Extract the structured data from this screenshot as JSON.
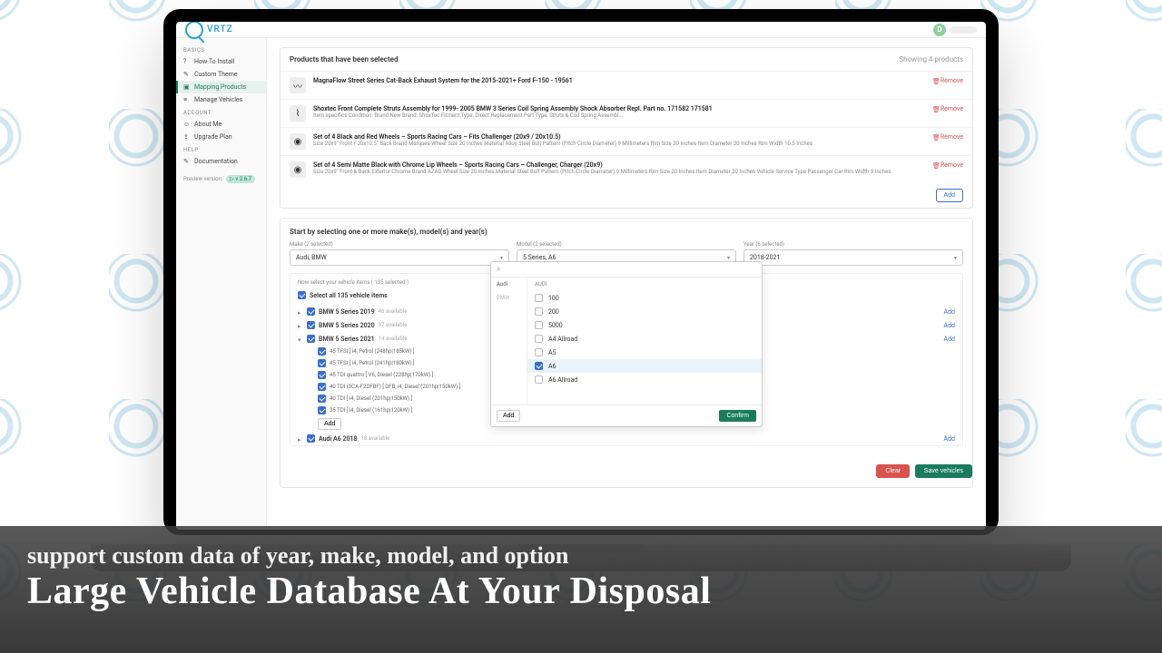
{
  "brand": "VRTZ",
  "avatar_letter": "D",
  "sidebar": {
    "groups": [
      {
        "label": "BASICS",
        "items": [
          {
            "label": "How To Install",
            "icon": "?",
            "active": false
          },
          {
            "label": "Custom Theme",
            "icon": "✎",
            "active": false
          },
          {
            "label": "Mapping Products",
            "icon": "▣",
            "active": true
          },
          {
            "label": "Manage Vehicles",
            "icon": "≡",
            "active": false
          }
        ]
      },
      {
        "label": "ACCOUNT",
        "items": [
          {
            "label": "About Me",
            "icon": "☺",
            "active": false
          },
          {
            "label": "Upgrade Plan",
            "icon": "⇪",
            "active": false
          }
        ]
      },
      {
        "label": "HELP",
        "items": [
          {
            "label": "Documentation",
            "icon": "✎",
            "active": false
          }
        ]
      }
    ],
    "preview_label": "Preview version:",
    "version": "▷ v 2.6.7"
  },
  "products_panel": {
    "title": "Products that have been selected",
    "count_label": "Showing 4 products",
    "remove_label": "Remove",
    "add_label": "Add",
    "items": [
      {
        "title": "MagnaFlow Street Series Cat-Back Exhaust System for the 2015-2021+ Ford F-150 - 19561",
        "sub": ""
      },
      {
        "title": "Shoxtec Front Complete Struts Assembly for 1999- 2005 BMW 3 Series Coil Spring Assembly Shock Absorber Repl. Part no. 171582 171581",
        "sub": "Item specifics Condition: Brand New Brand: ShoxTec Fitment Type: Direct Replacement Part Type: Struts & Coil Spring Assembl..."
      },
      {
        "title": "Set of 4 Black and Red Wheels – Sports Racing Cars – Fits Challenger (20x9 / 20x10.5)",
        "sub": "Size 20x9\" Front / 20x10.5\" Back Brand Marquee Wheel Size 20 Inches Material Alloy Steel Bolt Pattern (Pitch Circle Diameter) 9 Millimeters Rim Size 20 Inches Item Diameter 20 Inches Rim Width 10.5 Inches"
      },
      {
        "title": "Set of 4 Semi Matte Black with Chrome Lip Wheels – Sports Racing Cars – Challenger, Charger (20x9)",
        "sub": "Size 20x9\" Front & Back Exterior Chrome Brand AZAD Wheel Size 20 Inches Material Steel Bolt Pattern (Pitch Circle Diameter) 9 Millimeters Rim Size 20 Inches Item Diameter 20 Inches Vehicle Service Type Passenger Car Rim Width 9 Inches"
      }
    ]
  },
  "step": {
    "title": "Start by selecting one or more make(s), model(s) and year(s)",
    "make": {
      "label": "Make (2 selected)",
      "value": "Audi, BMW"
    },
    "model": {
      "label": "Model (2 selected)",
      "value": "5 Series, A6"
    },
    "year": {
      "label": "Year (6 selected)",
      "value": "2018-2021"
    }
  },
  "tree": {
    "head": "Now select your vehicle items ( 135 selected )",
    "select_all": "Select all 135 vehicle items",
    "add_label": "Add",
    "groups": [
      {
        "label": "BMW 5 Series 2019",
        "avail": "46 available",
        "expanded": false
      },
      {
        "label": "BMW 5 Series 2020",
        "avail": "37 available",
        "expanded": false
      },
      {
        "label": "BMW 5 Series 2021",
        "avail": "14 available",
        "expanded": true,
        "children": [
          "45 TFSI [ i4, Petrol (248hp|185kW) ]",
          "45 TFSI [ i4, Petrol (241hp|180kW) ]",
          "45 TDI quattro [ V6, Diesel (228hp|170kW) ]",
          "40 TDI (3CA-F2DFBF) [ DFB, i4, Diesel (201hp|150kW) ]",
          "40 TDI [ i4, Diesel (201hp|150kW) ]",
          "35 TDI [ i4, Diesel (161hp|120kW) ]"
        ]
      },
      {
        "label": "Audi A6 2018",
        "avail": "18 available",
        "expanded": false
      }
    ]
  },
  "dropdown": {
    "makes": [
      "Audi",
      "BMW"
    ],
    "heading": "AUDI",
    "options": [
      {
        "label": "100",
        "checked": false
      },
      {
        "label": "200",
        "checked": false
      },
      {
        "label": "5000",
        "checked": false
      },
      {
        "label": "A4 Allroad",
        "checked": false
      },
      {
        "label": "A5",
        "checked": false
      },
      {
        "label": "A6",
        "checked": true
      },
      {
        "label": "A6 Allroad",
        "checked": false
      }
    ],
    "add": "Add",
    "confirm": "Confirm"
  },
  "footer": {
    "clear": "Clear",
    "save": "Save vehicles"
  },
  "caption": {
    "sub": "support custom data of year, make, model, and option",
    "main": "Large Vehicle Database At Your Disposal"
  }
}
